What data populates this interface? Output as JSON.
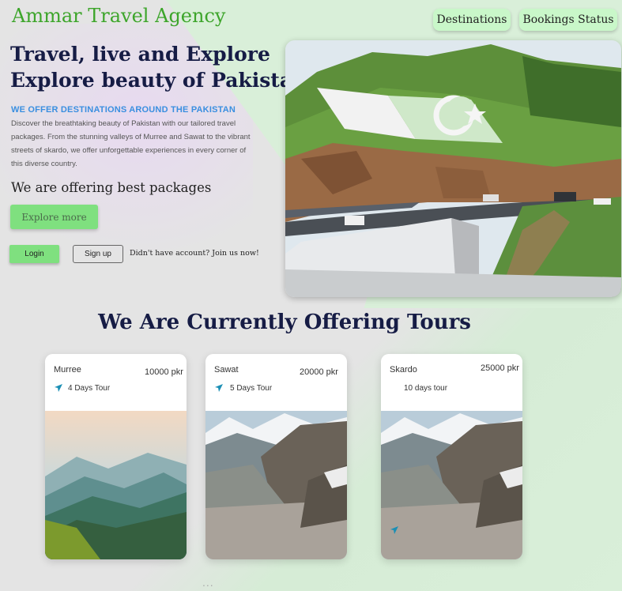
{
  "brand": "Ammar Travel Agency",
  "nav": {
    "destinations": "Destinations",
    "bookings": "Bookings Status"
  },
  "hero": {
    "headline_line1": "Travel, live and Explore",
    "headline_line2": "Explore beauty of Pakistan",
    "eyebrow": "WE OFFER DESTINATIONS AROUND THE PAKISTAN",
    "description": "Discover the breathtaking beauty of Pakistan with our tailored travel packages. From the stunning valleys of Murree and Sawat to the vibrant streets of skardo, we offer unforgettable experiences in every corner of this diverse country.",
    "packages_text": "We are offering best packages",
    "explore_label": "Explore more"
  },
  "auth": {
    "login": "Login",
    "signup": "Sign up",
    "account_text": "Didn't have account? Join us now!"
  },
  "tours": {
    "title": "We Are Currently Offering Tours",
    "items": [
      {
        "name": "Murree",
        "price": "10000 pkr",
        "days": "4 Days Tour"
      },
      {
        "name": "Sawat",
        "price": "20000 pkr",
        "days": "5 Days Tour"
      },
      {
        "name": "Skardo",
        "price": "25000 pkr",
        "days": "10 days tour"
      }
    ]
  },
  "footer_dots": "...",
  "colors": {
    "accent_green": "#7fe07f",
    "brand_green": "#3da52b",
    "navy": "#161c45",
    "eyebrow_blue": "#3a8fe0"
  }
}
